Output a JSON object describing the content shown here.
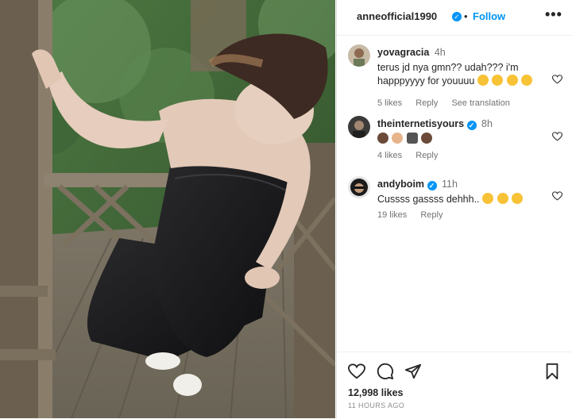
{
  "post": {
    "username": "anneofficial1990",
    "verified_glyph": "✓",
    "separator": "•",
    "follow_label": "Follow",
    "more_glyph": "•••",
    "likes": "12,998 likes",
    "time_ago": "11 HOURS AGO"
  },
  "comments": [
    {
      "username": "yovagracia",
      "time": "4h",
      "text": "terus jd nya gmn?? udah??? i'm happpyyyy for youuuu",
      "emoji": [
        "smiling-face-with-hearts",
        "kissing-face",
        "kissing-face",
        "face-savoring-food"
      ],
      "likes": "5 likes",
      "reply": "Reply",
      "translate": "See translation",
      "verified": false
    },
    {
      "username": "theinternetisyours",
      "time": "8h",
      "text": "",
      "emoji": [
        "woman-emoji",
        "man-emoji",
        "microphone-emoji",
        "woman-emoji"
      ],
      "likes": "4 likes",
      "reply": "Reply",
      "verified": true
    },
    {
      "username": "andyboim",
      "time": "11h",
      "text": "Cussss gassss dehhh..",
      "emoji": [
        "sunglasses-face",
        "sunglasses-face",
        "sunglasses-face"
      ],
      "likes": "19 likes",
      "reply": "Reply",
      "verified": true
    }
  ],
  "colors": {
    "accent": "#0095f6",
    "text": "#262626",
    "muted": "#737373",
    "emoji_yellow": "#f7c235"
  },
  "icons": [
    "heart-icon",
    "comment-icon",
    "share-icon",
    "save-icon",
    "more-icon",
    "verified-icon"
  ]
}
